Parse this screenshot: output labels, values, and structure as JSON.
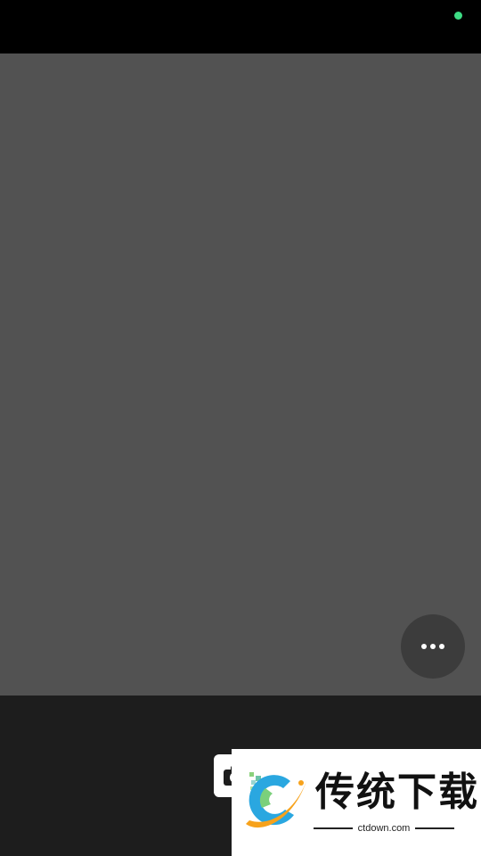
{
  "status_bar": {
    "camera_indicator_color": "#3ddc84"
  },
  "viewfinder": {
    "background_color": "#525252",
    "more_button_icon": "more-horizontal-icon"
  },
  "bottom_bar": {
    "camera_button_icon": "camera-icon"
  },
  "watermark": {
    "logo_icon": "ctdown-logo-icon",
    "title": "传统下载",
    "url": "ctdown.com"
  }
}
